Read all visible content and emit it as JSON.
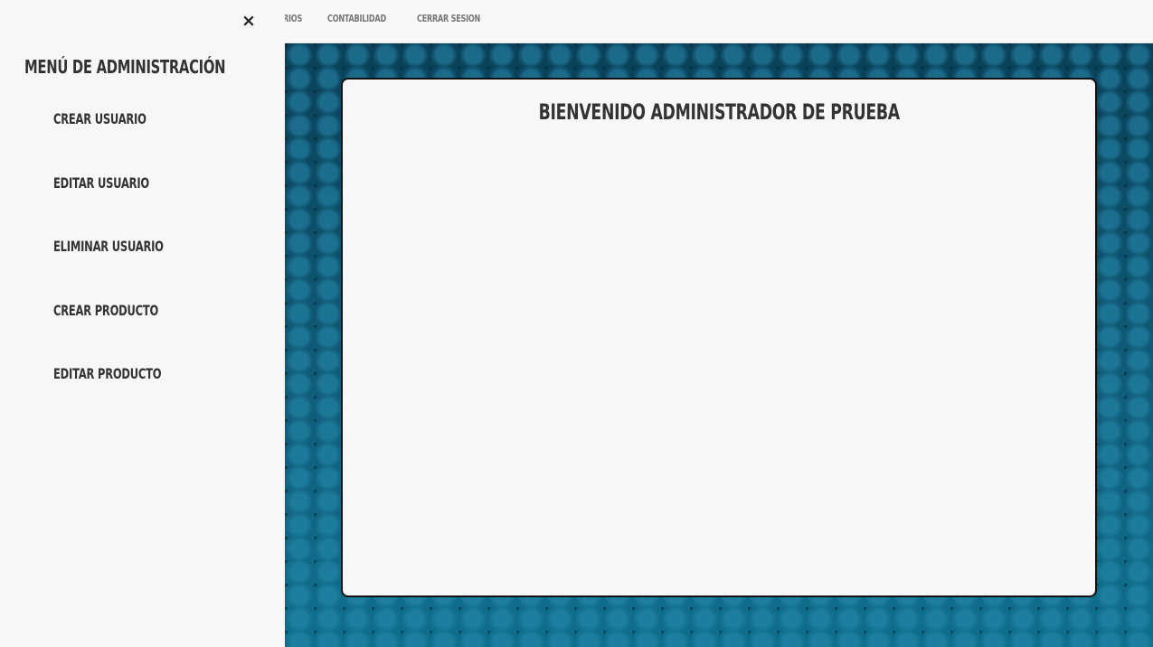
{
  "topnav": {
    "links": [
      {
        "label": "ARIOS"
      },
      {
        "label": "CONTABILIDAD"
      },
      {
        "label": "CERRAR SESION"
      }
    ]
  },
  "sidebar": {
    "close_icon": "×",
    "title": "MENÚ DE ADMINISTRACIÓN",
    "items": [
      {
        "label": "CREAR USUARIO"
      },
      {
        "label": "EDITAR USUARIO"
      },
      {
        "label": "ELIMINAR USUARIO"
      },
      {
        "label": "CREAR PRODUCTO"
      },
      {
        "label": "EDITAR PRODUCTO"
      }
    ]
  },
  "main": {
    "welcome": "BIENVENIDO ADMINISTRADOR DE PRUEBA"
  },
  "colors": {
    "background_pattern": "#0f5774",
    "panel": "#f7f7f7",
    "text": "#333333"
  }
}
